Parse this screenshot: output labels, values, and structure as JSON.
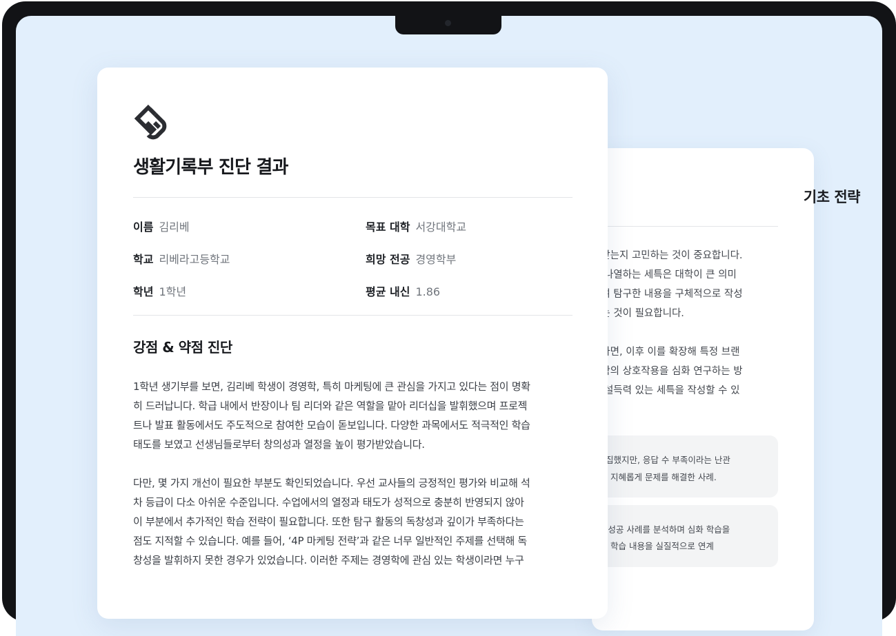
{
  "main_card": {
    "title": "생활기록부 진단 결과",
    "info": {
      "name": {
        "label": "이름",
        "value": "김리베"
      },
      "school": {
        "label": "학교",
        "value": "리베라고등학교"
      },
      "grade": {
        "label": "학년",
        "value": "1학년"
      },
      "target_univ": {
        "label": "목표 대학",
        "value": "서강대학교"
      },
      "major": {
        "label": "희망 전공",
        "value": "경영학부"
      },
      "gpa": {
        "label": "평균 내신",
        "value": "1.86"
      }
    },
    "section_title": "강점 & 약점 진단",
    "paragraph1": [
      "1학년 생기부를 보면, 김리베 학생이 경영학, 특히 마케팅에 큰 관심을 가지고 있다는 점이 명확",
      "히 드러납니다. 학급 내에서 반장이나 팀 리더와 같은 역할을 맡아 리더십을 발휘했으며 프로젝",
      "트나 발표 활동에서도 주도적으로 참여한 모습이 돋보입니다. 다양한 과목에서도 적극적인 학습",
      "태도를 보였고 선생님들로부터 창의성과 열정을 높이 평가받았습니다."
    ],
    "paragraph2": [
      "다만, 몇 가지 개선이 필요한 부분도 확인되었습니다. 우선 교사들의 긍정적인 평가와 비교해 석",
      "차 등급이 다소 아쉬운 수준입니다. 수업에서의 열정과 태도가 성적으로 충분히 반영되지 않아",
      "이 부분에서 추가적인 학습 전략이 필요합니다. 또한 탐구 활동의 독창성과 깊이가 부족하다는",
      "점도 지적할 수 있습니다. 예를 들어, ‘4P 마케팅 전략’과 같은 너무 일반적인 주제를 선택해 독",
      "창성을 발휘하지 못한 경우가 있었습니다. 이러한 주제는 경영학에 관심 있는 학생이라면 누구"
    ]
  },
  "back_card": {
    "title": "기초 전략",
    "paragraph1": [
      "가받는지 고민하는 것이 중요합니다.",
      "을 나열하는 세특은 대학이 큰 의미",
      "하여 탐구한 내용을 구체적으로 작성",
      "주는 것이 필요합니다."
    ],
    "paragraph2": [
      "했다면, 이후 이를 확장해 특정 브랜",
      "리학의 상호작용을 심화 연구하는 방",
      " 더 설득력 있는 세특을 작성할 수 있"
    ],
    "case1": [
      "- 수집했지만, 응답 수 부족이라는 난관",
      "용해 지혜롭게 문제를 해결한 사례."
    ],
    "case2": [
      "E의 성공 사례를 분석하며 심화 학습을",
      " 통해 학습 내용을 실질적으로 연계"
    ]
  }
}
